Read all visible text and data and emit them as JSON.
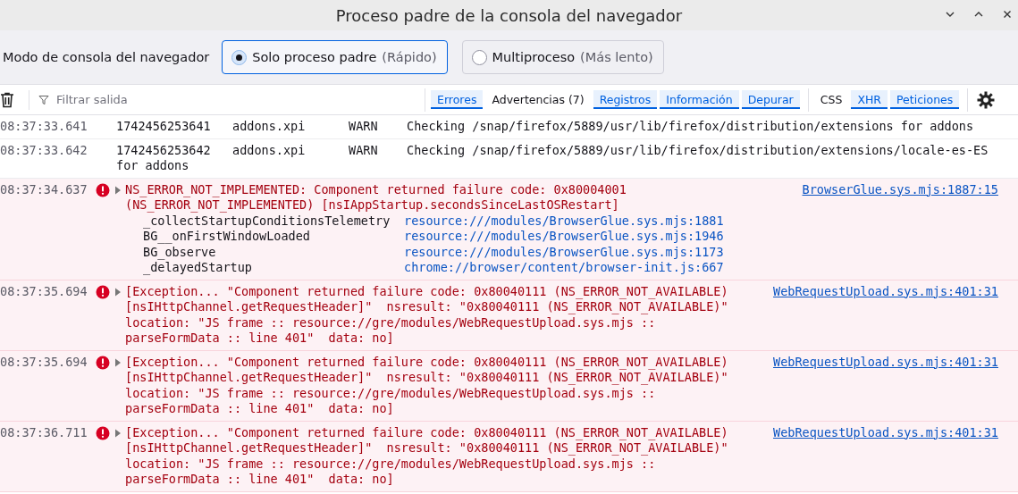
{
  "window": {
    "title": "Proceso padre de la consola del navegador"
  },
  "console_mode": {
    "label": "Modo de consola del navegador",
    "options": [
      {
        "label": "Solo proceso padre",
        "hint": "(Rápido)",
        "selected": true
      },
      {
        "label": "Multiproceso",
        "hint": "(Más lento)",
        "selected": false
      }
    ]
  },
  "filter": {
    "placeholder": "Filtrar salida"
  },
  "level_filters": [
    {
      "label": "Errores",
      "selected": true
    },
    {
      "label": "Advertencias (7)",
      "selected": false
    },
    {
      "label": "Registros",
      "selected": true
    },
    {
      "label": "Información",
      "selected": true
    },
    {
      "label": "Depurar",
      "selected": true
    }
  ],
  "type_filters": [
    {
      "label": "CSS",
      "selected": false
    },
    {
      "label": "XHR",
      "selected": true
    },
    {
      "label": "Peticiones",
      "selected": true
    }
  ],
  "messages": [
    {
      "kind": "log",
      "time": "08:37:33.641",
      "text": "1742456253641   addons.xpi      WARN    Checking /snap/firefox/5889/usr/lib/firefox/distribution/extensions for addons"
    },
    {
      "kind": "log",
      "time": "08:37:33.642",
      "text": "1742456253642   addons.xpi      WARN    Checking /snap/firefox/5889/usr/lib/firefox/distribution/extensions/locale-es-ES for addons"
    },
    {
      "kind": "error",
      "time": "08:37:34.637",
      "text": "NS_ERROR_NOT_IMPLEMENTED: Component returned failure code: 0x80004001 (NS_ERROR_NOT_IMPLEMENTED) [nsIAppStartup.secondsSinceLastOSRestart]",
      "source": "BrowserGlue.sys.mjs:1887:15",
      "stack": [
        {
          "function": "_collectStartupConditionsTelemetry",
          "location": "resource:///modules/BrowserGlue.sys.mjs:1881"
        },
        {
          "function": "BG__onFirstWindowLoaded",
          "location": "resource:///modules/BrowserGlue.sys.mjs:1946"
        },
        {
          "function": "BG_observe",
          "location": "resource:///modules/BrowserGlue.sys.mjs:1173"
        },
        {
          "function": "_delayedStartup",
          "location": "chrome://browser/content/browser-init.js:667"
        }
      ]
    },
    {
      "kind": "error",
      "time": "08:37:35.694",
      "text": "[Exception... \"Component returned failure code: 0x80040111 (NS_ERROR_NOT_AVAILABLE) [nsIHttpChannel.getRequestHeader]\"  nsresult: \"0x80040111 (NS_ERROR_NOT_AVAILABLE)\" location: \"JS frame :: resource://gre/modules/WebRequestUpload.sys.mjs :: parseFormData :: line 401\"  data: no]",
      "source": "WebRequestUpload.sys.mjs:401:31"
    },
    {
      "kind": "error",
      "time": "08:37:35.694",
      "text": "[Exception... \"Component returned failure code: 0x80040111 (NS_ERROR_NOT_AVAILABLE) [nsIHttpChannel.getRequestHeader]\"  nsresult: \"0x80040111 (NS_ERROR_NOT_AVAILABLE)\" location: \"JS frame :: resource://gre/modules/WebRequestUpload.sys.mjs :: parseFormData :: line 401\"  data: no]",
      "source": "WebRequestUpload.sys.mjs:401:31"
    },
    {
      "kind": "error",
      "time": "08:37:36.711",
      "text": "[Exception... \"Component returned failure code: 0x80040111 (NS_ERROR_NOT_AVAILABLE) [nsIHttpChannel.getRequestHeader]\"  nsresult: \"0x80040111 (NS_ERROR_NOT_AVAILABLE)\" location: \"JS frame :: resource://gre/modules/WebRequestUpload.sys.mjs :: parseFormData :: line 401\"  data: no]",
      "source": "WebRequestUpload.sys.mjs:401:31"
    }
  ]
}
